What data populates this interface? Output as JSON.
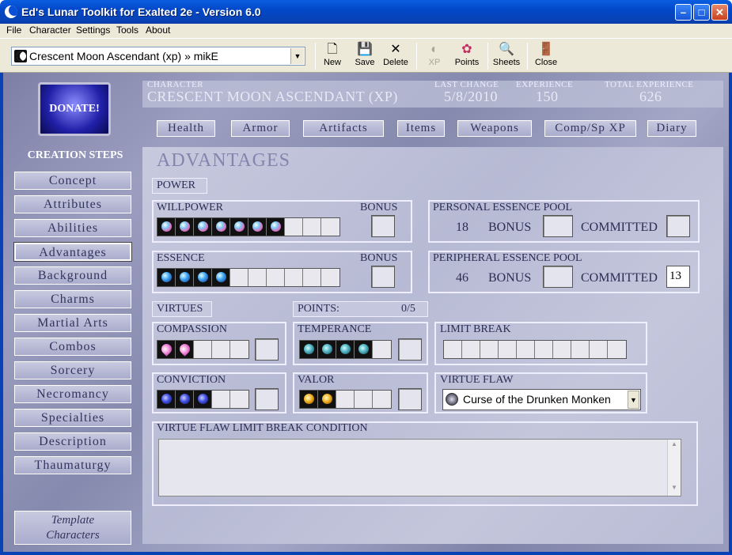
{
  "window": {
    "title": "Ed's Lunar Toolkit for Exalted 2e - Version 6.0"
  },
  "menu": [
    "File",
    "Character",
    "Settings",
    "Tools",
    "About"
  ],
  "toolbar": {
    "character_value": "Crescent Moon Ascendant (xp) » mikE",
    "buttons": {
      "new": "New",
      "save": "Save",
      "delete": "Delete",
      "xp": "XP",
      "points": "Points",
      "sheets": "Sheets",
      "close": "Close"
    }
  },
  "sidebar": {
    "donate": "DONATE!",
    "heading": "CREATION STEPS",
    "steps": [
      "Concept",
      "Attributes",
      "Abilities",
      "Advantages",
      "Background",
      "Charms",
      "Martial Arts",
      "Combos",
      "Sorcery",
      "Necromancy",
      "Specialties",
      "Description",
      "Thaumaturgy"
    ],
    "active_step": "Advantages",
    "template_line1": "Template",
    "template_line2": "Characters"
  },
  "header": {
    "character_label": "CHARACTER",
    "character_value": "CRESCENT MOON ASCENDANT (XP)",
    "last_change_label": "LAST CHANGE",
    "last_change_value": "5/8/2010",
    "experience_label": "EXPERIENCE",
    "experience_value": "150",
    "total_experience_label": "TOTAL EXPERIENCE",
    "total_experience_value": "626"
  },
  "nav": [
    "Health",
    "Armor",
    "Artifacts",
    "Items",
    "Weapons",
    "Comp/Sp XP",
    "Diary"
  ],
  "advantages": {
    "title": "ADVANTAGES",
    "power_label": "POWER",
    "willpower": {
      "label": "WILLPOWER",
      "bonus_label": "BONUS",
      "filled": 7,
      "max": 10,
      "bonus": ""
    },
    "essence": {
      "label": "ESSENCE",
      "bonus_label": "BONUS",
      "filled": 4,
      "max": 10,
      "bonus": ""
    },
    "personal_pool": {
      "label": "PERSONAL ESSENCE POOL",
      "value": "18",
      "bonus_label": "BONUS",
      "bonus": "",
      "committed_label": "COMMITTED",
      "committed": ""
    },
    "peripheral_pool": {
      "label": "PERIPHERAL ESSENCE POOL",
      "value": "46",
      "bonus_label": "BONUS",
      "bonus": "",
      "committed_label": "COMMITTED",
      "committed": "13"
    },
    "virtues_label": "VIRTUES",
    "points_label": "POINTS:",
    "points_value": "0/5",
    "compassion": {
      "label": "COMPASSION",
      "filled": 2,
      "max": 5
    },
    "temperance": {
      "label": "TEMPERANCE",
      "filled": 4,
      "max": 5
    },
    "conviction": {
      "label": "CONVICTION",
      "filled": 3,
      "max": 5
    },
    "valor": {
      "label": "VALOR",
      "filled": 2,
      "max": 5
    },
    "limit_break": {
      "label": "LIMIT BREAK",
      "filled": 0,
      "max": 10
    },
    "virtue_flaw": {
      "label": "VIRTUE FLAW",
      "value": "Curse of the Drunken Monken"
    },
    "condition_label": "VIRTUE FLAW LIMIT BREAK CONDITION",
    "condition_value": ""
  }
}
